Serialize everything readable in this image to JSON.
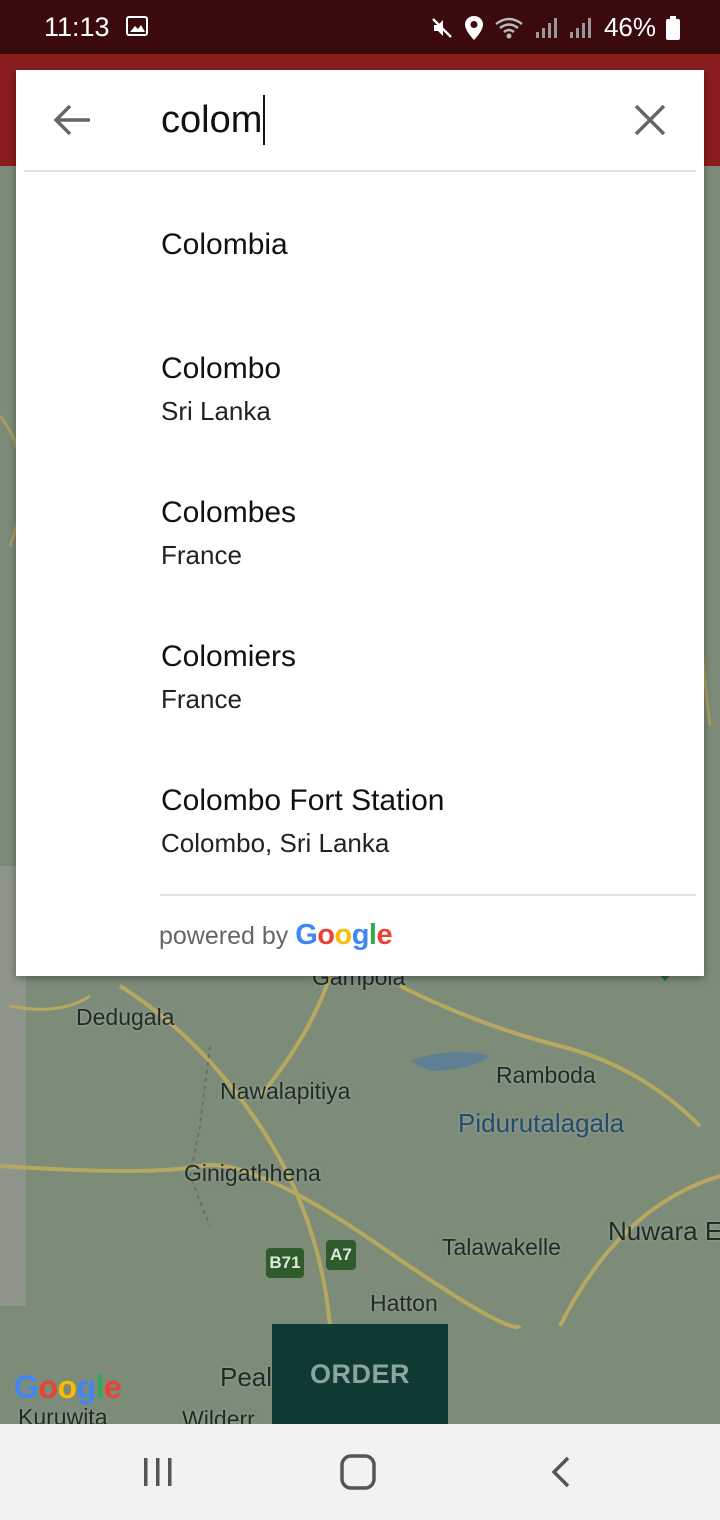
{
  "status_bar": {
    "time": "11:13",
    "battery": "46%",
    "icons": [
      "image-icon",
      "mute-icon",
      "location-icon",
      "wifi-icon",
      "signal-icon",
      "signal-icon",
      "battery-icon"
    ]
  },
  "search": {
    "query": "colom",
    "back_icon": "arrow-left-icon",
    "clear_icon": "close-icon"
  },
  "results": [
    {
      "primary": "Colombia",
      "secondary": ""
    },
    {
      "primary": "Colombo",
      "secondary": "Sri Lanka"
    },
    {
      "primary": "Colombes",
      "secondary": "France"
    },
    {
      "primary": "Colomiers",
      "secondary": "France"
    },
    {
      "primary": "Colombo Fort Station",
      "secondary": "Colombo, Sri Lanka"
    }
  ],
  "attribution": {
    "prefix": "powered by",
    "brand_letters": [
      "G",
      "o",
      "o",
      "g",
      "l",
      "e"
    ]
  },
  "map": {
    "labels": {
      "dedugala": "Dedugala",
      "nawalapitiya": "Nawalapitiya",
      "ramboda": "Ramboda",
      "pidurutalagala": "Pidurutalagala",
      "ginigathhena": "Ginigathhena",
      "nuwara": "Nuwara E",
      "talawakelle": "Talawakelle",
      "hatton": "Hatton",
      "gampola": "Gampola",
      "peak": "Peal",
      "kuruwita": "Kuruwita",
      "wilderness": "Wilderr"
    },
    "shields": {
      "b71": "B71",
      "a7": "A7"
    },
    "logo_letters": [
      "G",
      "o",
      "o",
      "g",
      "l",
      "e"
    ]
  },
  "order_button": {
    "label": "ORDER"
  },
  "colors": {
    "status_bar": "#3a0a0c",
    "header": "#8a1c1e",
    "order_button": "#0e3a33",
    "google_blue": "#4285F4",
    "google_red": "#EA4335",
    "google_yellow": "#FBBC05",
    "google_green": "#34A853"
  },
  "nav_bar": {
    "recents_icon": "recents-icon",
    "home_icon": "home-icon",
    "back_icon": "back-chevron-icon"
  }
}
